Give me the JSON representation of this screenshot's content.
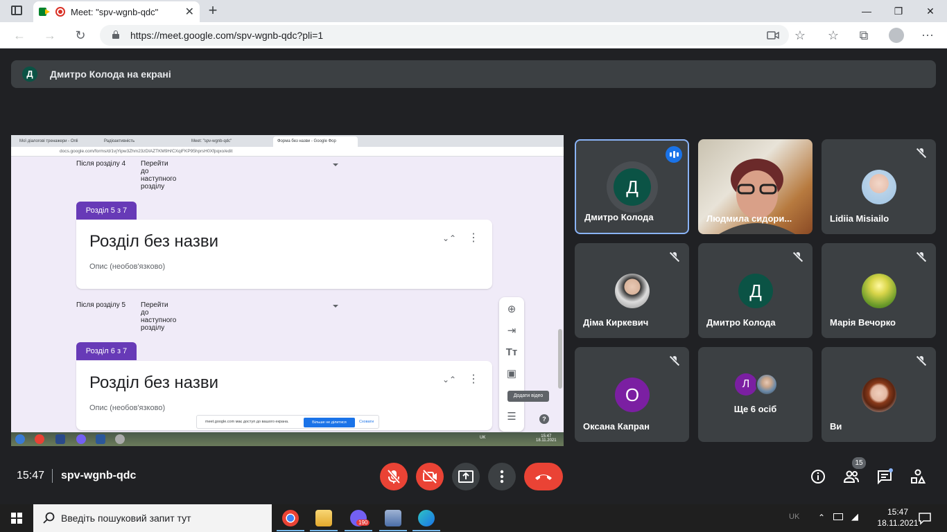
{
  "browser": {
    "tab_title": "Meet: \"spv-wgnb-qdc\"",
    "new_tab_label": "+",
    "url": "https://meet.google.com/spv-wgnb-qdc?pli=1"
  },
  "presenter_bar": {
    "avatar_letter": "Д",
    "text": "Дмитро Колода на екрані"
  },
  "shared_screen": {
    "tabs": [
      "Мої діалогові тренажери - Onli",
      "Радіоактивність",
      "Meet: \"spv-wgnb-qdc\"",
      "Форма без назви - Google Фор"
    ],
    "url": "docs.google.com/forms/d/1vjYipw3Zhm23zDlAZTKM9H/CXqiFKP95hprsH0Xfpqxo/edit",
    "after_section_4": "Після розділу 4",
    "after_section_5": "Після розділу 5",
    "go_next": "Перейти до наступного розділу",
    "section5_chip": "Розділ 5 з 7",
    "section6_chip": "Розділ 6 з 7",
    "section_title": "Розділ без назви",
    "section_desc": "Опис (необов'язково)",
    "tooltip": "Додати відео",
    "help": "?",
    "notice_text": "meet.google.com має доступ до вашого екрана.",
    "notice_button": "Більше не ділитися",
    "notice_hide": "Сховати",
    "clock_time": "15:47",
    "clock_date": "18.11.2021",
    "lang": "UK"
  },
  "participants": [
    {
      "name": "Дмитро Колода",
      "avatar": "Д",
      "color": "#0b5345",
      "state": "speaking"
    },
    {
      "name": "Людмила сидори...",
      "avatar": "",
      "color": "",
      "state": "video"
    },
    {
      "name": "Lidiia Misiailo",
      "avatar": "",
      "color": "",
      "state": "muted"
    },
    {
      "name": "Діма Киркевич",
      "avatar": "",
      "color": "",
      "state": "muted"
    },
    {
      "name": "Дмитро Колода",
      "avatar": "Д",
      "color": "#0b5345",
      "state": "muted"
    },
    {
      "name": "Марія Вечорко",
      "avatar": "",
      "color": "",
      "state": "muted"
    },
    {
      "name": "Оксана Капран",
      "avatar": "О",
      "color": "#7b1fa2",
      "state": "muted"
    },
    {
      "name": "Ще 6 осіб",
      "avatar": "Л",
      "color": "#7b1fa2",
      "state": "group"
    },
    {
      "name": "Ви",
      "avatar": "",
      "color": "",
      "state": "muted"
    }
  ],
  "bottom_bar": {
    "time": "15:47",
    "meeting_code": "spv-wgnb-qdc",
    "people_count": "15"
  },
  "taskbar": {
    "search_placeholder": "Введіть пошуковий запит тут",
    "viber_badge": "190",
    "lang": "UK",
    "time": "15:47",
    "date": "18.11.2021"
  },
  "colors": {
    "meet_bg": "#202124",
    "tile_bg": "#3c4043",
    "end_call_red": "#ea4335",
    "forms_purple": "#673ab7",
    "speaking_blue": "#1a73e8"
  }
}
